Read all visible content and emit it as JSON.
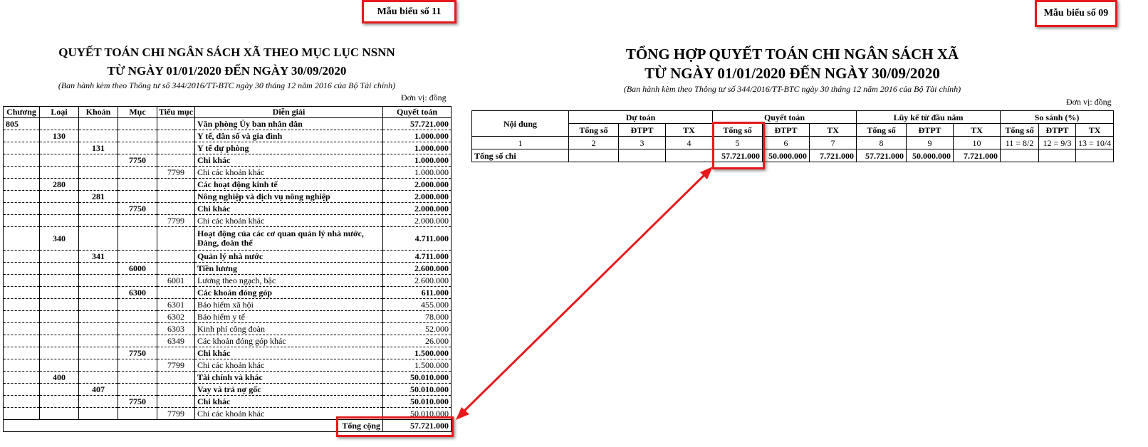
{
  "left": {
    "form_number": "Mẫu biểu số 11",
    "title_line1": "QUYẾT TOÁN CHI NGÂN SÁCH XÃ THEO MỤC LỤC NSNN",
    "title_line2": "TỪ NGÀY 01/01/2020 ĐẾN NGÀY 30/09/2020",
    "subtitle": "(Ban hành kèm theo Thông tư số 344/2016/TT-BTC ngày 30 tháng 12 năm 2016 của Bộ Tài chính)",
    "unit": "Đơn vị: đồng",
    "columns": [
      "Chương",
      "Loại",
      "Khoản",
      "Mục",
      "Tiểu mục",
      "Diễn giải",
      "Quyết toán"
    ],
    "rows": [
      {
        "chuong": "805",
        "loai": "",
        "khoan": "",
        "muc": "",
        "tieu_muc": "",
        "dien_giai": "Văn phòng Ủy ban nhân dân",
        "quyet_toan": "57.721.000",
        "bold": true
      },
      {
        "chuong": "",
        "loai": "130",
        "khoan": "",
        "muc": "",
        "tieu_muc": "",
        "dien_giai": "Y tế, dân số và gia đình",
        "quyet_toan": "1.000.000",
        "bold": true
      },
      {
        "chuong": "",
        "loai": "",
        "khoan": "131",
        "muc": "",
        "tieu_muc": "",
        "dien_giai": "Y tế dự phòng",
        "quyet_toan": "1.000.000",
        "bold": true
      },
      {
        "chuong": "",
        "loai": "",
        "khoan": "",
        "muc": "7750",
        "tieu_muc": "",
        "dien_giai": "Chi khác",
        "quyet_toan": "1.000.000",
        "bold": true
      },
      {
        "chuong": "",
        "loai": "",
        "khoan": "",
        "muc": "",
        "tieu_muc": "7799",
        "dien_giai": "Chi các khoản khác",
        "quyet_toan": "1.000.000",
        "bold": false
      },
      {
        "chuong": "",
        "loai": "280",
        "khoan": "",
        "muc": "",
        "tieu_muc": "",
        "dien_giai": "Các hoạt động kinh tế",
        "quyet_toan": "2.000.000",
        "bold": true
      },
      {
        "chuong": "",
        "loai": "",
        "khoan": "281",
        "muc": "",
        "tieu_muc": "",
        "dien_giai": "Nông nghiệp và dịch vụ nông nghiệp",
        "quyet_toan": "2.000.000",
        "bold": true
      },
      {
        "chuong": "",
        "loai": "",
        "khoan": "",
        "muc": "7750",
        "tieu_muc": "",
        "dien_giai": "Chi khác",
        "quyet_toan": "2.000.000",
        "bold": true
      },
      {
        "chuong": "",
        "loai": "",
        "khoan": "",
        "muc": "",
        "tieu_muc": "7799",
        "dien_giai": "Chi các khoản khác",
        "quyet_toan": "2.000.000",
        "bold": false
      },
      {
        "chuong": "",
        "loai": "340",
        "khoan": "",
        "muc": "",
        "tieu_muc": "",
        "dien_giai": "Hoạt động của các cơ quan quản lý nhà nước, Đảng, đoàn thể",
        "quyet_toan": "4.711.000",
        "bold": true,
        "tall": true
      },
      {
        "chuong": "",
        "loai": "",
        "khoan": "341",
        "muc": "",
        "tieu_muc": "",
        "dien_giai": "Quản lý nhà nước",
        "quyet_toan": "4.711.000",
        "bold": true
      },
      {
        "chuong": "",
        "loai": "",
        "khoan": "",
        "muc": "6000",
        "tieu_muc": "",
        "dien_giai": "Tiền lương",
        "quyet_toan": "2.600.000",
        "bold": true
      },
      {
        "chuong": "",
        "loai": "",
        "khoan": "",
        "muc": "",
        "tieu_muc": "6001",
        "dien_giai": "Lương theo ngạch, bậc",
        "quyet_toan": "2.600.000",
        "bold": false
      },
      {
        "chuong": "",
        "loai": "",
        "khoan": "",
        "muc": "6300",
        "tieu_muc": "",
        "dien_giai": "Các khoản đóng góp",
        "quyet_toan": "611.000",
        "bold": true
      },
      {
        "chuong": "",
        "loai": "",
        "khoan": "",
        "muc": "",
        "tieu_muc": "6301",
        "dien_giai": "Bảo hiểm xã hội",
        "quyet_toan": "455.000",
        "bold": false
      },
      {
        "chuong": "",
        "loai": "",
        "khoan": "",
        "muc": "",
        "tieu_muc": "6302",
        "dien_giai": "Bảo hiểm y tế",
        "quyet_toan": "78.000",
        "bold": false
      },
      {
        "chuong": "",
        "loai": "",
        "khoan": "",
        "muc": "",
        "tieu_muc": "6303",
        "dien_giai": "Kinh phí công đoàn",
        "quyet_toan": "52.000",
        "bold": false
      },
      {
        "chuong": "",
        "loai": "",
        "khoan": "",
        "muc": "",
        "tieu_muc": "6349",
        "dien_giai": "Các khoản đóng góp khác",
        "quyet_toan": "26.000",
        "bold": false
      },
      {
        "chuong": "",
        "loai": "",
        "khoan": "",
        "muc": "7750",
        "tieu_muc": "",
        "dien_giai": "Chi khác",
        "quyet_toan": "1.500.000",
        "bold": true
      },
      {
        "chuong": "",
        "loai": "",
        "khoan": "",
        "muc": "",
        "tieu_muc": "7799",
        "dien_giai": "Chi các khoản khác",
        "quyet_toan": "1.500.000",
        "bold": false
      },
      {
        "chuong": "",
        "loai": "400",
        "khoan": "",
        "muc": "",
        "tieu_muc": "",
        "dien_giai": "Tài chính và khác",
        "quyet_toan": "50.010.000",
        "bold": true
      },
      {
        "chuong": "",
        "loai": "",
        "khoan": "407",
        "muc": "",
        "tieu_muc": "",
        "dien_giai": "Vay và trả nợ gốc",
        "quyet_toan": "50.010.000",
        "bold": true
      },
      {
        "chuong": "",
        "loai": "",
        "khoan": "",
        "muc": "7750",
        "tieu_muc": "",
        "dien_giai": "Chi khác",
        "quyet_toan": "50.010.000",
        "bold": true
      },
      {
        "chuong": "",
        "loai": "",
        "khoan": "",
        "muc": "",
        "tieu_muc": "7799",
        "dien_giai": "Chi các khoản khác",
        "quyet_toan": "50.010.000",
        "bold": false
      }
    ],
    "total_label": "Tổng cộng",
    "total_value": "57.721.000"
  },
  "right": {
    "form_number": "Mẫu biểu số 09",
    "title_line1": "TỔNG HỢP QUYẾT TOÁN CHI NGÂN SÁCH XÃ",
    "title_line2": "TỪ NGÀY 01/01/2020 ĐẾN NGÀY 30/09/2020",
    "subtitle": "(Ban hành kèm theo Thông tư số 344/2016/TT-BTC ngày 30 tháng 12 năm 2016 của Bộ Tài chính)",
    "unit": "Đơn vị: đồng",
    "header_content": "Nội dung",
    "groups": [
      "Dự toán",
      "Quyết toán",
      "Lũy kế từ đầu năm",
      "So sánh (%)"
    ],
    "sub_headers": [
      "Tổng số",
      "ĐTPT",
      "TX",
      "Tổng số",
      "ĐTPT",
      "TX",
      "Tổng số",
      "ĐTPT",
      "TX",
      "Tổng số",
      "ĐTPT",
      "TX"
    ],
    "index_row": [
      "1",
      "2",
      "3",
      "4",
      "5",
      "6",
      "7",
      "8",
      "9",
      "10",
      "11 = 8/2",
      "12 = 9/3",
      "13 = 10/4"
    ],
    "total_row": {
      "label": "Tổng số chi",
      "values": [
        "",
        "",
        "",
        "57.721.000",
        "50.000.000",
        "7.721.000",
        "57.721.000",
        "50.000.000",
        "7.721.000",
        "",
        "",
        ""
      ]
    }
  },
  "colors": {
    "highlight": "#e8191c"
  }
}
